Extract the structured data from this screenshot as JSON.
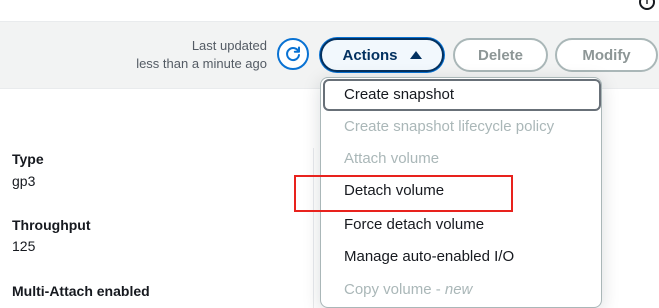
{
  "header": {
    "info_icon_char": "i",
    "last_updated_line1": "Last updated",
    "last_updated_line2": "less than a minute ago",
    "refresh_icon": "refresh-icon",
    "actions_label": "Actions",
    "delete_label": "Delete",
    "modify_label": "Modify"
  },
  "details": {
    "type_label": "Type",
    "type_value": "gp3",
    "throughput_label": "Throughput",
    "throughput_value": "125",
    "multi_attach_label": "Multi-Attach enabled"
  },
  "actions_menu": {
    "items": [
      {
        "label": "Create snapshot",
        "state": "highlighted"
      },
      {
        "label": "Create snapshot lifecycle policy",
        "state": "disabled"
      },
      {
        "label": "Attach volume",
        "state": "disabled"
      },
      {
        "label": "Detach volume",
        "state": "enabled"
      },
      {
        "label": "Force detach volume",
        "state": "enabled"
      },
      {
        "label": "Manage auto-enabled I/O",
        "state": "enabled"
      },
      {
        "label": "Copy volume - ",
        "tag": "new",
        "state": "disabled"
      }
    ]
  },
  "colors": {
    "primary_blue": "#0972d3",
    "annotation_red": "#e8221d",
    "disabled_text": "#aab7b8"
  }
}
